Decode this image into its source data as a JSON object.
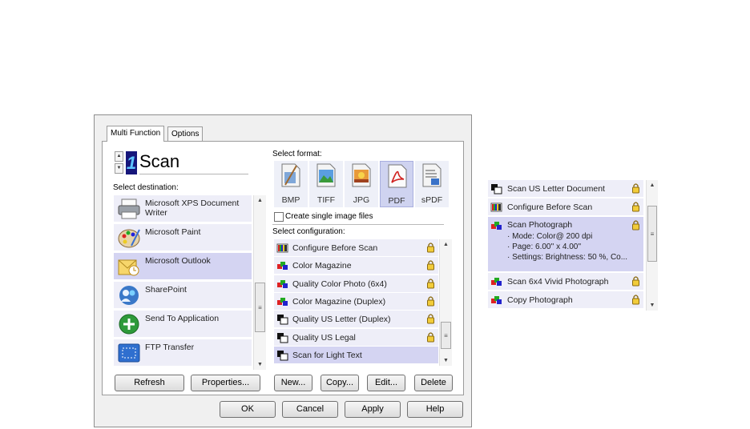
{
  "tabs": [
    "Multi Function",
    "Options"
  ],
  "scan_button": {
    "number": "1",
    "name": "Scan"
  },
  "destination": {
    "label": "Select destination:",
    "items": [
      {
        "label": "Microsoft XPS Document Writer",
        "icon": "printer-icon",
        "selected": false
      },
      {
        "label": "Microsoft Paint",
        "icon": "paint-palette-icon",
        "selected": false
      },
      {
        "label": "Microsoft Outlook",
        "icon": "outlook-icon",
        "selected": true
      },
      {
        "label": "SharePoint",
        "icon": "sharepoint-icon",
        "selected": false
      },
      {
        "label": "Send To Application",
        "icon": "send-to-app-icon",
        "selected": false
      },
      {
        "label": "FTP Transfer",
        "icon": "ftp-icon",
        "selected": false
      }
    ]
  },
  "format": {
    "label": "Select format:",
    "items": [
      {
        "label": "BMP",
        "icon": "bmp-file-icon",
        "selected": false
      },
      {
        "label": "TIFF",
        "icon": "tiff-file-icon",
        "selected": false
      },
      {
        "label": "JPG",
        "icon": "jpg-file-icon",
        "selected": false
      },
      {
        "label": "PDF",
        "icon": "pdf-file-icon",
        "selected": true
      },
      {
        "label": "sPDF",
        "icon": "spdf-file-icon",
        "selected": false
      }
    ],
    "single_image_label": "Create single image files",
    "single_image_checked": false
  },
  "configuration": {
    "label": "Select configuration:",
    "items": [
      {
        "label": "Configure Before Scan",
        "icon": "configure-icon",
        "locked": true,
        "selected": false
      },
      {
        "label": "Color Magazine",
        "icon": "color-config-icon",
        "locked": true,
        "selected": false
      },
      {
        "label": "Quality Color Photo (6x4)",
        "icon": "color-config-icon",
        "locked": true,
        "selected": false
      },
      {
        "label": "Color Magazine (Duplex)",
        "icon": "color-config-icon",
        "locked": true,
        "selected": false
      },
      {
        "label": "Quality US Letter (Duplex)",
        "icon": "bw-config-icon",
        "locked": true,
        "selected": false
      },
      {
        "label": "Quality US Legal",
        "icon": "bw-config-icon",
        "locked": true,
        "selected": false
      },
      {
        "label": "Scan for Light Text",
        "icon": "bw-config-icon",
        "locked": false,
        "selected": true
      }
    ]
  },
  "left_buttons": {
    "refresh": "Refresh",
    "properties": "Properties..."
  },
  "config_buttons": {
    "new": "New...",
    "copy": "Copy...",
    "edit": "Edit...",
    "delete": "Delete"
  },
  "dialog_buttons": {
    "ok": "OK",
    "cancel": "Cancel",
    "apply": "Apply",
    "help": "Help"
  },
  "detail_list": {
    "items": [
      {
        "label": "Scan US Letter Document",
        "icon": "bw-config-icon",
        "locked": true
      },
      {
        "label": "Configure Before Scan",
        "icon": "configure-icon",
        "locked": true
      }
    ],
    "expanded": {
      "label": "Scan Photograph",
      "icon": "color-config-icon",
      "locked": true,
      "details": [
        "· Mode: Color@ 200 dpi",
        "· Page:  6.00'' x  4.00''",
        "· Settings: Brightness: 50 %, Co..."
      ]
    },
    "items_after": [
      {
        "label": "Scan 6x4 Vivid Photograph",
        "icon": "color-config-icon",
        "locked": true
      },
      {
        "label": "Copy Photograph",
        "icon": "color-config-icon",
        "locked": true
      }
    ]
  },
  "colors": {
    "list_bg": "#eeeef8",
    "selected_bg": "#d4d4f2",
    "digit_bg": "#16167a"
  }
}
